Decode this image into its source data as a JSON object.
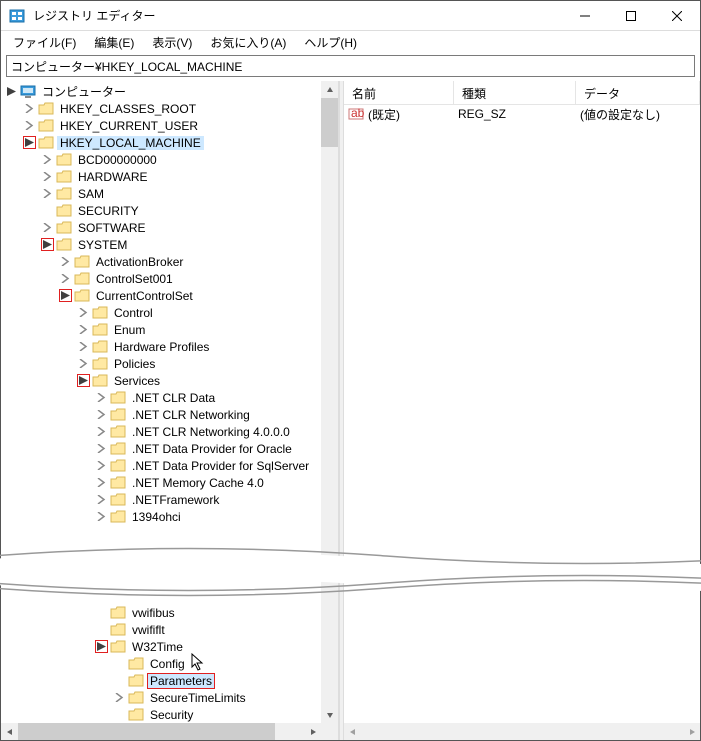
{
  "window": {
    "title": "レジストリ エディター"
  },
  "menu": {
    "file": "ファイル(F)",
    "edit": "編集(E)",
    "view": "表示(V)",
    "favorites": "お気に入り(A)",
    "help": "ヘルプ(H)"
  },
  "address": "コンピューター¥HKEY_LOCAL_MACHINE",
  "tree": {
    "root": "コンピューター",
    "hkcr": "HKEY_CLASSES_ROOT",
    "hkcu": "HKEY_CURRENT_USER",
    "hklm": "HKEY_LOCAL_MACHINE",
    "bcd": "BCD00000000",
    "hardware": "HARDWARE",
    "sam": "SAM",
    "security": "SECURITY",
    "software": "SOFTWARE",
    "system": "SYSTEM",
    "activation": "ActivationBroker",
    "cs001": "ControlSet001",
    "ccs": "CurrentControlSet",
    "control": "Control",
    "enum": "Enum",
    "hwprofiles": "Hardware Profiles",
    "policies": "Policies",
    "services": "Services",
    "netclr": ".NET CLR Data",
    "netclrnet": ".NET CLR Networking",
    "netclrnet4": ".NET CLR Networking 4.0.0.0",
    "netoracle": ".NET Data Provider for Oracle",
    "netsql": ".NET Data Provider for SqlServer",
    "netmem": ".NET Memory Cache 4.0",
    "netfw": ".NETFramework",
    "ohci": "1394ohci",
    "vwifibus": "vwifibus",
    "vwififlt": "vwififlt",
    "w32time": "W32Time",
    "config": "Config",
    "parameters": "Parameters",
    "securetime": "SecureTimeLimits",
    "security2": "Security"
  },
  "list": {
    "cols": {
      "name": "名前",
      "type": "種類",
      "data": "データ"
    },
    "row": {
      "name": "(既定)",
      "type": "REG_SZ",
      "data": "(値の設定なし)"
    }
  }
}
